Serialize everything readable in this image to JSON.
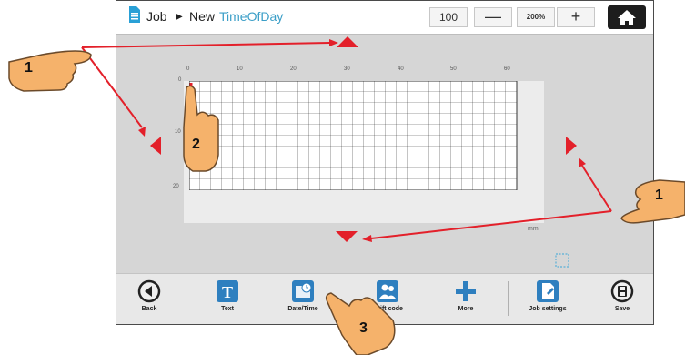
{
  "header": {
    "crumb_job": "Job",
    "crumb_separator": "▶",
    "crumb_new": "New",
    "job_name": "TimeOfDay",
    "zoom_value": "100",
    "zoom_minus": "—",
    "zoom_percent": "200%",
    "zoom_plus": "+"
  },
  "canvas": {
    "ruler_x_labels": [
      "0",
      "10",
      "20",
      "30",
      "40",
      "50",
      "60"
    ],
    "ruler_y_labels": [
      "0",
      "10",
      "20"
    ],
    "unit": "mm"
  },
  "toolbar": {
    "items": [
      {
        "label": "Back",
        "icon": "back-icon"
      },
      {
        "label": "Text",
        "icon": "text-icon"
      },
      {
        "label": "Date/Time",
        "icon": "date-time-icon"
      },
      {
        "label": "Shift code",
        "icon": "shift-code-icon"
      },
      {
        "label": "More",
        "icon": "plus-icon"
      },
      {
        "label": "Job settings",
        "icon": "job-settings-icon"
      },
      {
        "label": "Save",
        "icon": "save-icon"
      }
    ]
  },
  "callouts": {
    "left_hand": "1",
    "right_hand": "1",
    "cursor_hand": "2",
    "toolbar_hand": "3"
  },
  "colors": {
    "accent": "#3a9ec7",
    "arrow_red": "#e3202a",
    "icon_blue": "#2e7fbf",
    "hand_orange": "#f5b26b"
  }
}
